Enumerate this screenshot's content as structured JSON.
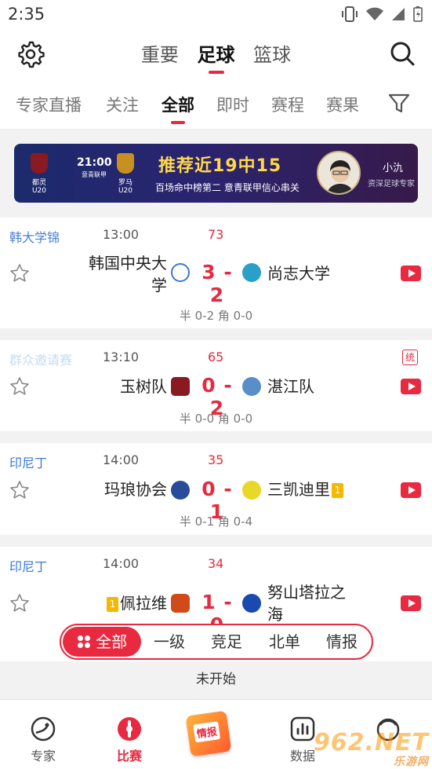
{
  "status_bar": {
    "time": "2:35"
  },
  "header": {
    "sport_tabs": [
      "重要",
      "足球",
      "篮球"
    ],
    "active_sport": "足球"
  },
  "tabs": [
    "专家直播",
    "关注",
    "全部",
    "即时",
    "赛程",
    "赛果"
  ],
  "active_tab": "全部",
  "banner": {
    "home_team": "都灵U20",
    "away_team": "罗马U20",
    "kickoff": "21:00",
    "league": "意青联甲",
    "headline": "推荐近19中15",
    "subtitle": "百场命中榜第二 意青联甲信心串关",
    "expert_name": "小氿",
    "expert_desc": "资深足球专家"
  },
  "matches": [
    {
      "league": "韩大学锦",
      "league_color": "#4a7fd4",
      "time": "13:00",
      "minute": "73",
      "home": "韩国中央大学",
      "home_line1": "韩国中央大",
      "home_line2": "学",
      "score": "3 - 2",
      "away": "尚志大学",
      "half": "半 0-2 角 0-0",
      "home_logo_color": "#3a78d8",
      "away_logo_color": "#2aa0c8"
    },
    {
      "league": "群众邀请赛",
      "league_color": "#c4dcf2",
      "time": "13:10",
      "minute": "65",
      "home": "玉树队",
      "score": "0 - 2",
      "away": "湛江队",
      "half": "半 0-0 角 0-0",
      "stat_label": "统",
      "home_logo_color": "#8a1a22",
      "away_logo_color": "#5a8ec8"
    },
    {
      "league": "印尼丁",
      "league_color": "#3a78d8",
      "time": "14:00",
      "minute": "35",
      "home": "玛琅协会",
      "score": "0 - 1",
      "away": "三凯迪里",
      "away_card": "1",
      "half": "半 0-1 角 0-4",
      "home_logo_color": "#2a4a9a",
      "away_logo_color": "#e8d82a"
    },
    {
      "league": "印尼丁",
      "league_color": "#3a78d8",
      "time": "14:00",
      "minute": "34",
      "home": "佩拉维",
      "home_card": "1",
      "score": "1 - 0",
      "away": "努山塔拉之海",
      "away_line1": "努山塔拉之",
      "away_line2": "海",
      "home_logo_color": "#d04a1a",
      "away_logo_color": "#1a4ab0"
    }
  ],
  "segment_filter": {
    "items": [
      "全部",
      "一级",
      "竞足",
      "北单",
      "情报"
    ],
    "active": "全部"
  },
  "section_label": "未开始",
  "bottom_nav": {
    "items": [
      "专家",
      "比赛",
      "情报",
      "数据"
    ],
    "active": "比赛",
    "news_tile_label": "情报"
  },
  "watermark": {
    "brand": "962.NET",
    "sub": "乐游网"
  },
  "colors": {
    "accent": "#e8293f",
    "card_yellow": "#f5b800"
  }
}
